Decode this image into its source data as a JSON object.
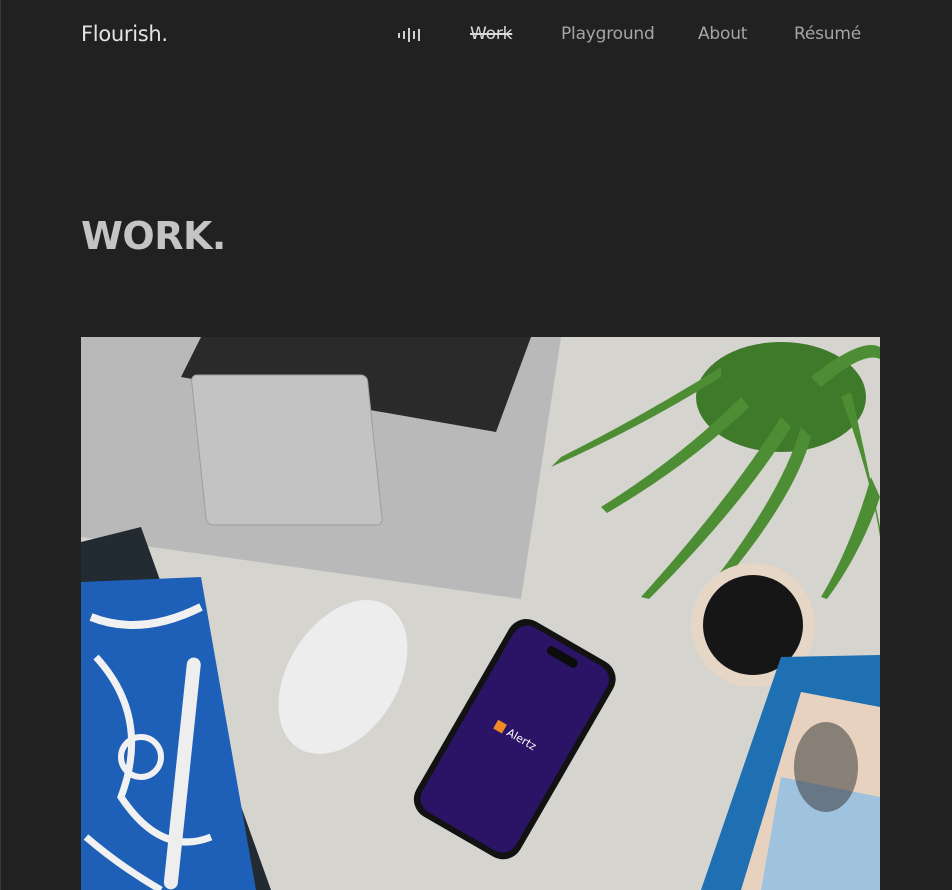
{
  "header": {
    "logo": "Flourish.",
    "nav_icon": "audio-waveform-icon",
    "nav": [
      {
        "label": "Work",
        "active": true
      },
      {
        "label": "Playground",
        "active": false
      },
      {
        "label": "About",
        "active": false
      },
      {
        "label": "Résumé",
        "active": false
      }
    ]
  },
  "main": {
    "title": "WORK.",
    "hero_image": {
      "description_icon": "desk-workspace-image",
      "phone_app_name": "Alertz"
    }
  },
  "colors": {
    "background": "#212121",
    "text": "#c4c4c4",
    "phone_screen": "#2b1466",
    "brand_orange": "#f08a24"
  }
}
